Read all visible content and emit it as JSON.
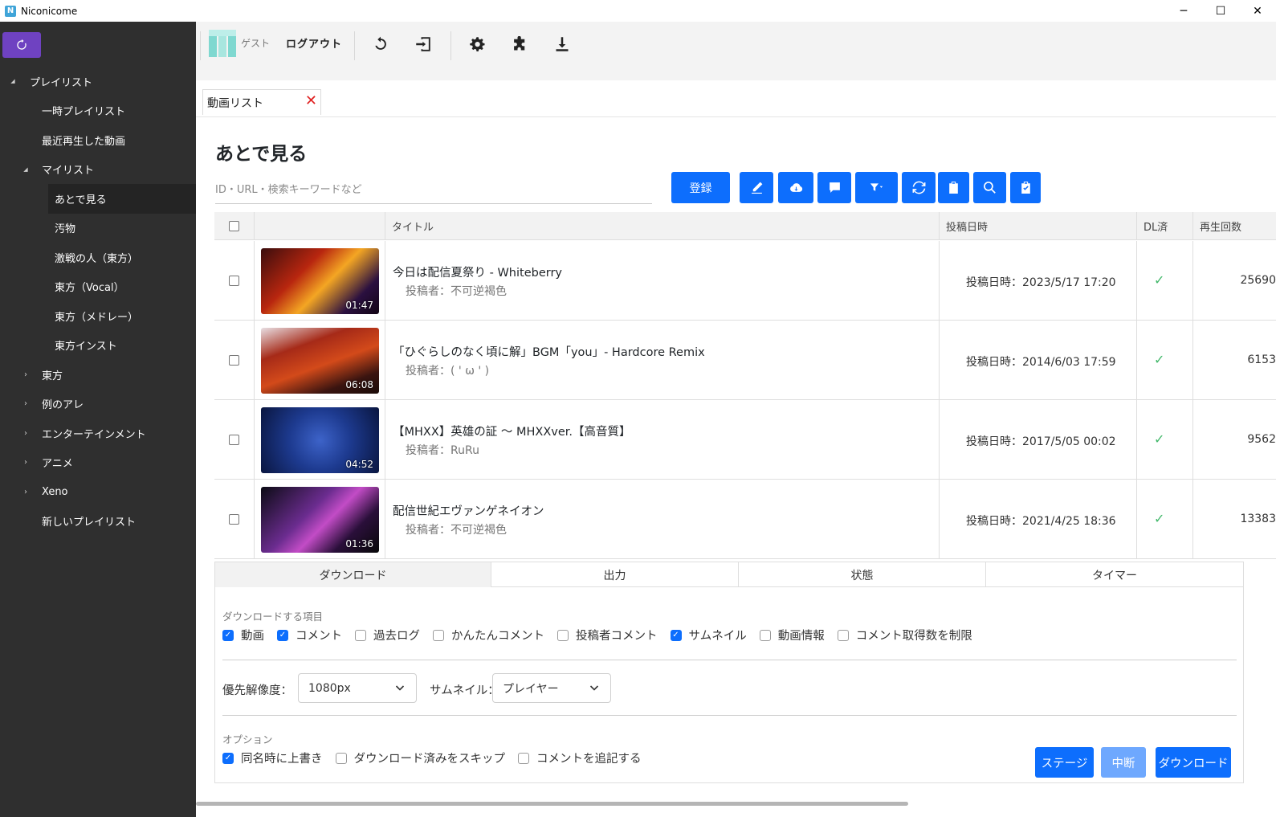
{
  "window": {
    "title": "Niconicome",
    "app_icon": "N",
    "minimize": "─",
    "maximize": "☐",
    "close": "✕"
  },
  "sidebar": {
    "refresh_icon": "refresh-icon",
    "items": [
      {
        "label": "プレイリスト",
        "toggle": "expanded"
      },
      {
        "label": "一時プレイリスト",
        "toggle": ""
      },
      {
        "label": "最近再生した動画",
        "toggle": ""
      },
      {
        "label": "マイリスト",
        "toggle": "expanded"
      },
      {
        "label": "あとで見る",
        "toggle": "",
        "selected": true
      },
      {
        "label": "汚物",
        "toggle": ""
      },
      {
        "label": "激戦の人（東方）",
        "toggle": ""
      },
      {
        "label": "東方（Vocal）",
        "toggle": ""
      },
      {
        "label": "東方（メドレー）",
        "toggle": ""
      },
      {
        "label": "東方インスト",
        "toggle": ""
      },
      {
        "label": "東方",
        "toggle": "collapsed"
      },
      {
        "label": "例のアレ",
        "toggle": "collapsed"
      },
      {
        "label": "エンターテインメント",
        "toggle": "collapsed"
      },
      {
        "label": "アニメ",
        "toggle": "collapsed"
      },
      {
        "label": "Xeno",
        "toggle": "collapsed"
      },
      {
        "label": "新しいプレイリスト",
        "toggle": ""
      }
    ]
  },
  "toolbar": {
    "user_name": "ゲスト",
    "logout_label": "ログアウト",
    "icons": [
      "restore-icon",
      "sign-in-icon",
      "gear-icon",
      "puzzle-icon",
      "download-icon"
    ]
  },
  "tabs": {
    "current_tab": "動画リスト",
    "close_glyph": "✕"
  },
  "page": {
    "title": "あとで見る",
    "search_placeholder": "ID・URL・検索キーワードなど",
    "register_label": "登録",
    "action_icons": [
      "pencil-icon",
      "cloud-download-icon",
      "comment-icon",
      "filter-icon",
      "sync-icon",
      "clipboard-icon",
      "search-icon",
      "clipboard-check-icon"
    ]
  },
  "table": {
    "headers": {
      "title": "タイトル",
      "date": "投稿日時",
      "dl": "DL済",
      "views": "再生回数"
    },
    "rows": [
      {
        "title": "今日は配信夏祭り - Whiteberry",
        "owner": "投稿者：不可逆褐色",
        "date": "投稿日時：2023/5/17 17:20",
        "duration": "01:47",
        "downloaded": "✓",
        "views": "25690"
      },
      {
        "title": "「ひぐらしのなく頃に解」BGM「you」- Hardcore Remix",
        "owner": "投稿者：( ' ω ' )",
        "date": "投稿日時：2014/6/03 17:59",
        "duration": "06:08",
        "downloaded": "✓",
        "views": "6153"
      },
      {
        "title": "【MHXX】英雄の証 ～ MHXXver.【高音質】",
        "owner": "投稿者：RuRu",
        "date": "投稿日時：2017/5/05 00:02",
        "duration": "04:52",
        "downloaded": "✓",
        "views": "9562"
      },
      {
        "title": "配信世紀エヴァンゲネイオン",
        "owner": "投稿者：不可逆褐色",
        "date": "投稿日時：2021/4/25 18:36",
        "duration": "01:36",
        "downloaded": "✓",
        "views": "13383"
      }
    ]
  },
  "panel": {
    "tabs": [
      "ダウンロード",
      "出力",
      "状態",
      "タイマー"
    ],
    "items_label": "ダウンロードする項目",
    "items": [
      {
        "label": "動画",
        "checked": true
      },
      {
        "label": "コメント",
        "checked": true
      },
      {
        "label": "過去ログ",
        "checked": false
      },
      {
        "label": "かんたんコメント",
        "checked": false
      },
      {
        "label": "投稿者コメント",
        "checked": false
      },
      {
        "label": "サムネイル",
        "checked": true
      },
      {
        "label": "動画情報",
        "checked": false
      },
      {
        "label": "コメント取得数を制限",
        "checked": false
      }
    ],
    "resolution_label": "優先解像度：",
    "resolution_value": "1080px",
    "thumbnail_label": "サムネイル：",
    "thumbnail_value": "プレイヤー",
    "options_label": "オプション",
    "options": [
      {
        "label": "同名時に上書き",
        "checked": true
      },
      {
        "label": "ダウンロード済みをスキップ",
        "checked": false
      },
      {
        "label": "コメントを追記する",
        "checked": false
      }
    ],
    "stage_label": "ステージ",
    "abort_label": "中断",
    "download_label": "ダウンロード"
  }
}
